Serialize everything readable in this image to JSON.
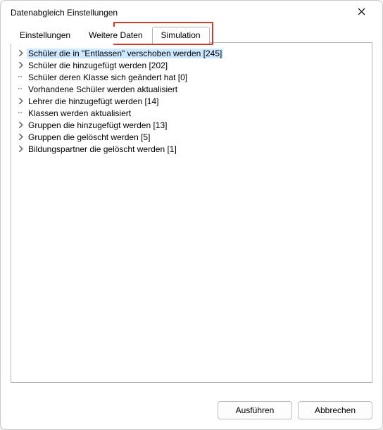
{
  "window": {
    "title": "Datenabgleich Einstellungen"
  },
  "tabs": {
    "items": [
      {
        "label": "Einstellungen"
      },
      {
        "label": "Weitere Daten"
      },
      {
        "label": "Simulation"
      }
    ],
    "active_index": 2
  },
  "tree": {
    "items": [
      {
        "expandable": true,
        "selected": true,
        "label": "Schüler die in \"Entlassen\" verschoben werden [245]"
      },
      {
        "expandable": true,
        "selected": false,
        "label": "Schüler die hinzugefügt werden [202]"
      },
      {
        "expandable": false,
        "selected": false,
        "label": "Schüler deren Klasse sich geändert hat [0]"
      },
      {
        "expandable": false,
        "selected": false,
        "label": "Vorhandene Schüler werden aktualisiert"
      },
      {
        "expandable": true,
        "selected": false,
        "label": "Lehrer die hinzugefügt werden [14]"
      },
      {
        "expandable": false,
        "selected": false,
        "label": "Klassen werden aktualisiert"
      },
      {
        "expandable": true,
        "selected": false,
        "label": "Gruppen die hinzugefügt werden [13]"
      },
      {
        "expandable": true,
        "selected": false,
        "label": "Gruppen die gelöscht werden [5]"
      },
      {
        "expandable": true,
        "selected": false,
        "label": "Bildungspartner die gelöscht werden [1]"
      }
    ]
  },
  "buttons": {
    "primary": "Ausführen",
    "secondary": "Abbrechen"
  },
  "highlight": {
    "target_tab_index": 2
  }
}
